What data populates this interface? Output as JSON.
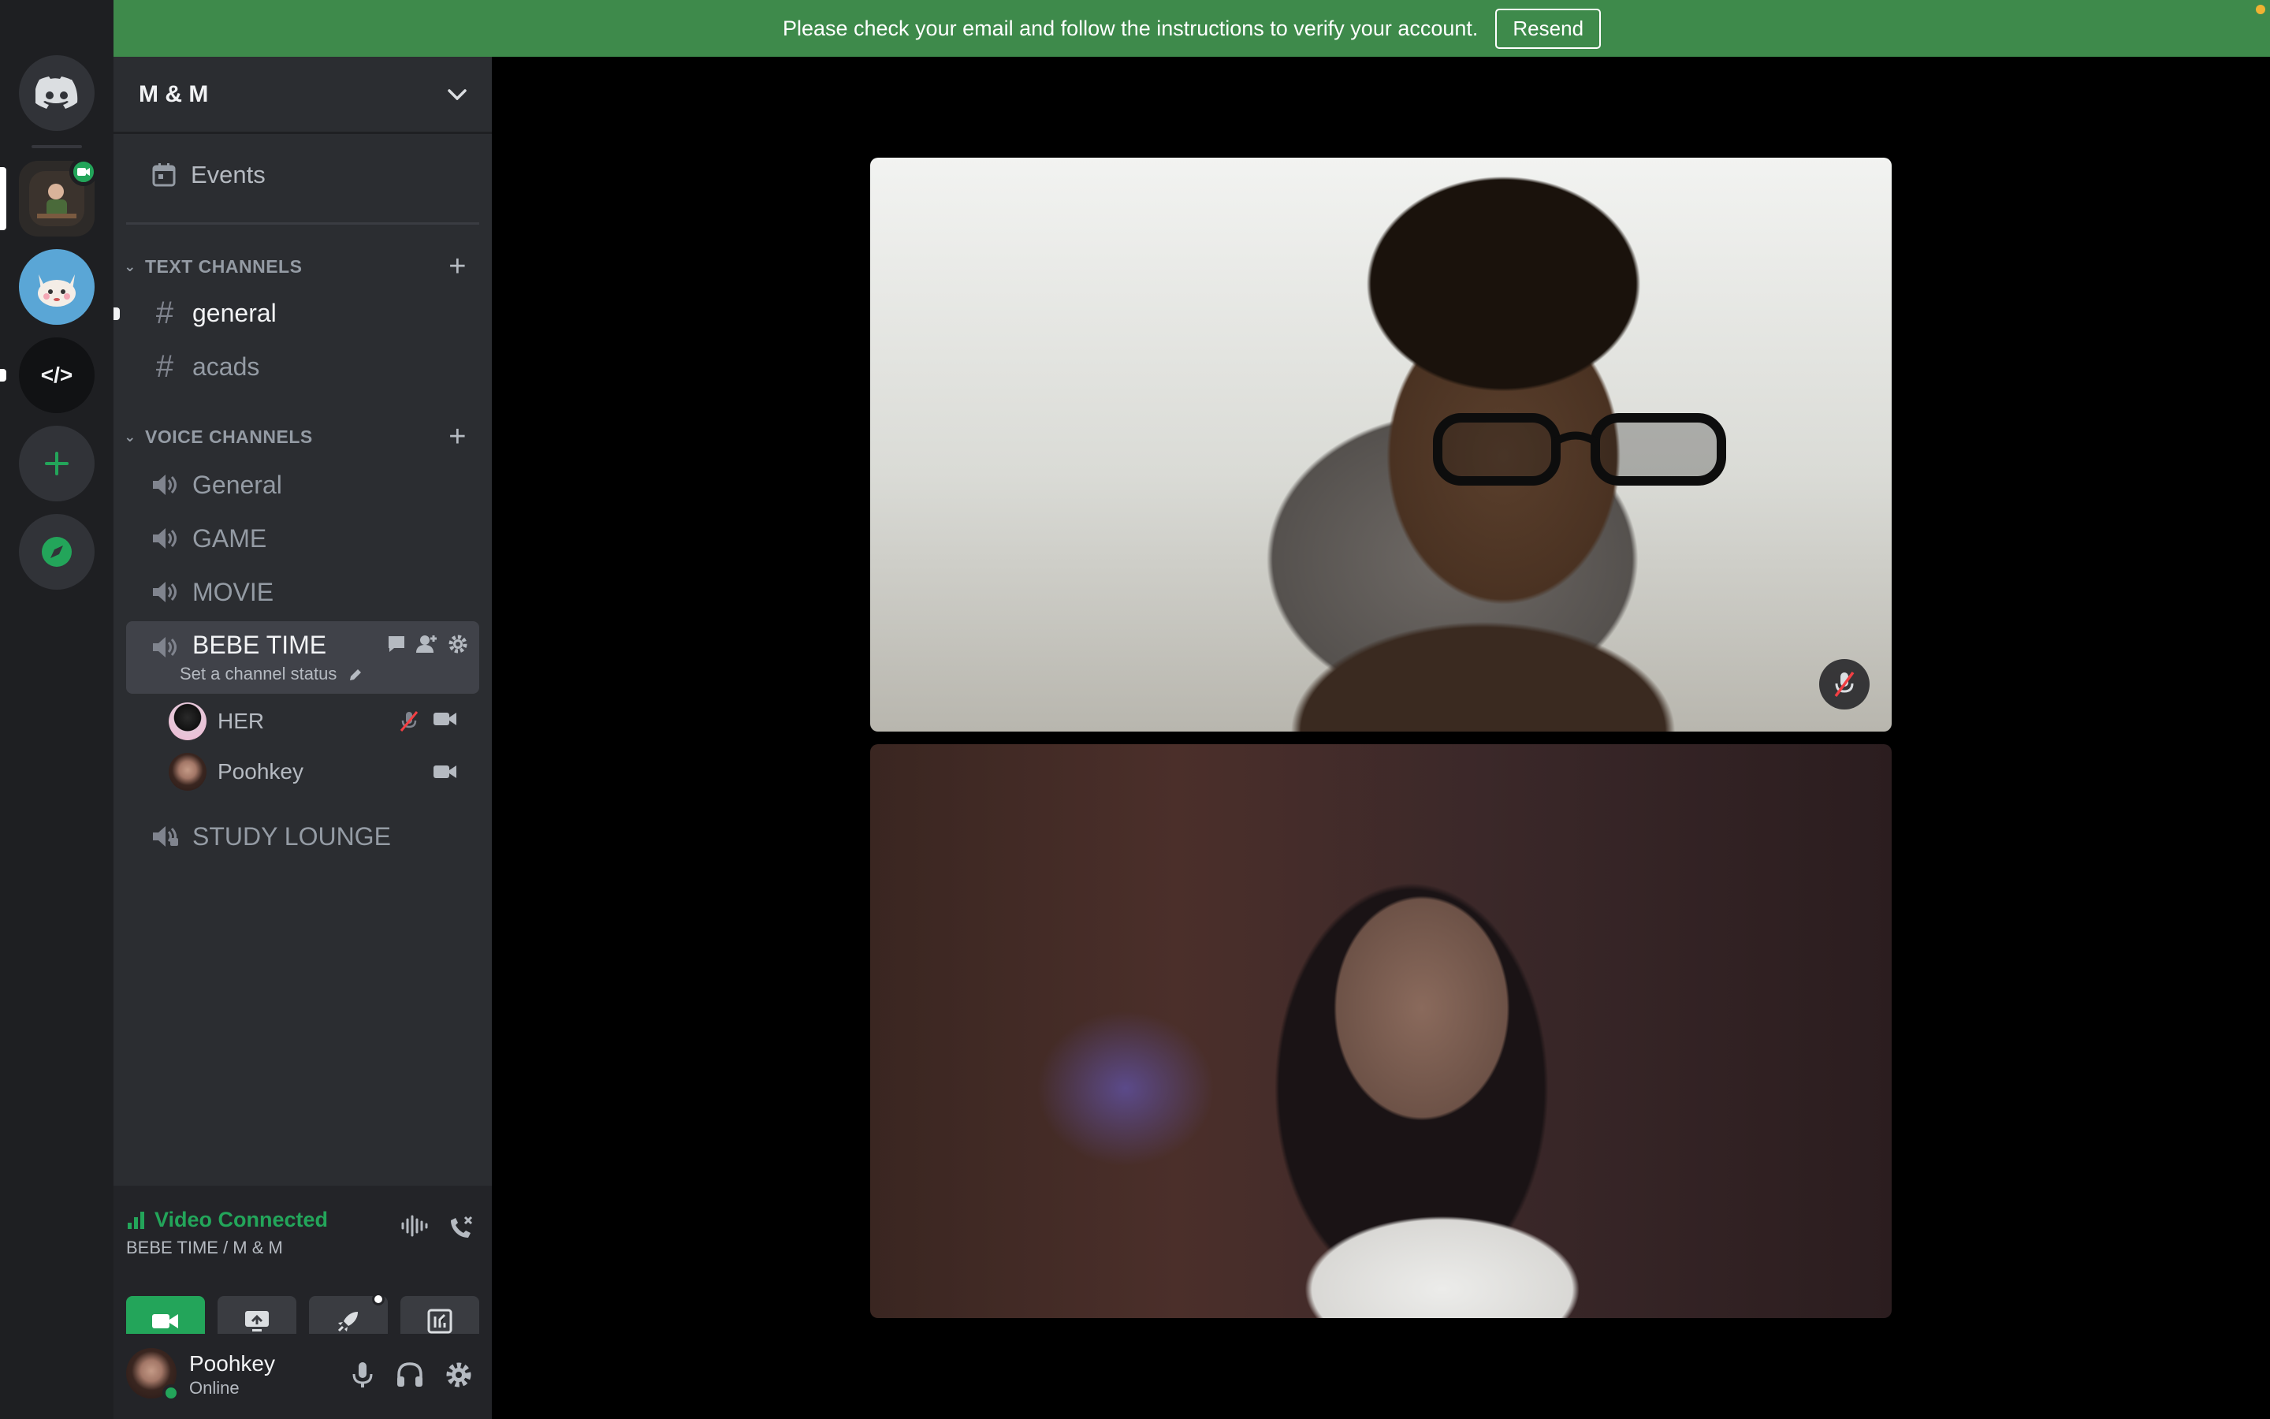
{
  "banner": {
    "message": "Please check your email and follow the instructions to verify your account.",
    "resend_label": "Resend"
  },
  "rail": {
    "items": [
      {
        "name": "home",
        "icon": "discord-logo-icon"
      },
      {
        "name": "server-bebe",
        "icon": "server-avatar-icon"
      },
      {
        "name": "server-cat",
        "icon": "cat-avatar-icon"
      },
      {
        "name": "server-code",
        "label": "</>"
      },
      {
        "name": "add-server",
        "icon": "plus-icon"
      },
      {
        "name": "explore",
        "icon": "compass-icon"
      }
    ],
    "accent": "#23a55a"
  },
  "guild": {
    "name": "M & M",
    "events_label": "Events"
  },
  "text_channels": {
    "category": "TEXT CHANNELS",
    "items": [
      {
        "name": "general"
      },
      {
        "name": "acads"
      }
    ]
  },
  "voice_channels": {
    "category": "VOICE CHANNELS",
    "items": [
      {
        "name": "General"
      },
      {
        "name": "GAME"
      },
      {
        "name": "MOVIE"
      },
      {
        "name": "BEBE TIME",
        "status_placeholder": "Set a channel status"
      },
      {
        "name": "STUDY LOUNGE"
      }
    ],
    "participants": [
      {
        "name": "HER"
      },
      {
        "name": "Poohkey"
      }
    ]
  },
  "voice_panel": {
    "title": "Video Connected",
    "subtitle": "BEBE TIME / M & M"
  },
  "user": {
    "name": "Poohkey",
    "status": "Online"
  },
  "colors": {
    "banner": "#3e8a4b",
    "connected": "#23a55a",
    "sidebar": "#2b2d31",
    "rail": "#1e1f22"
  }
}
